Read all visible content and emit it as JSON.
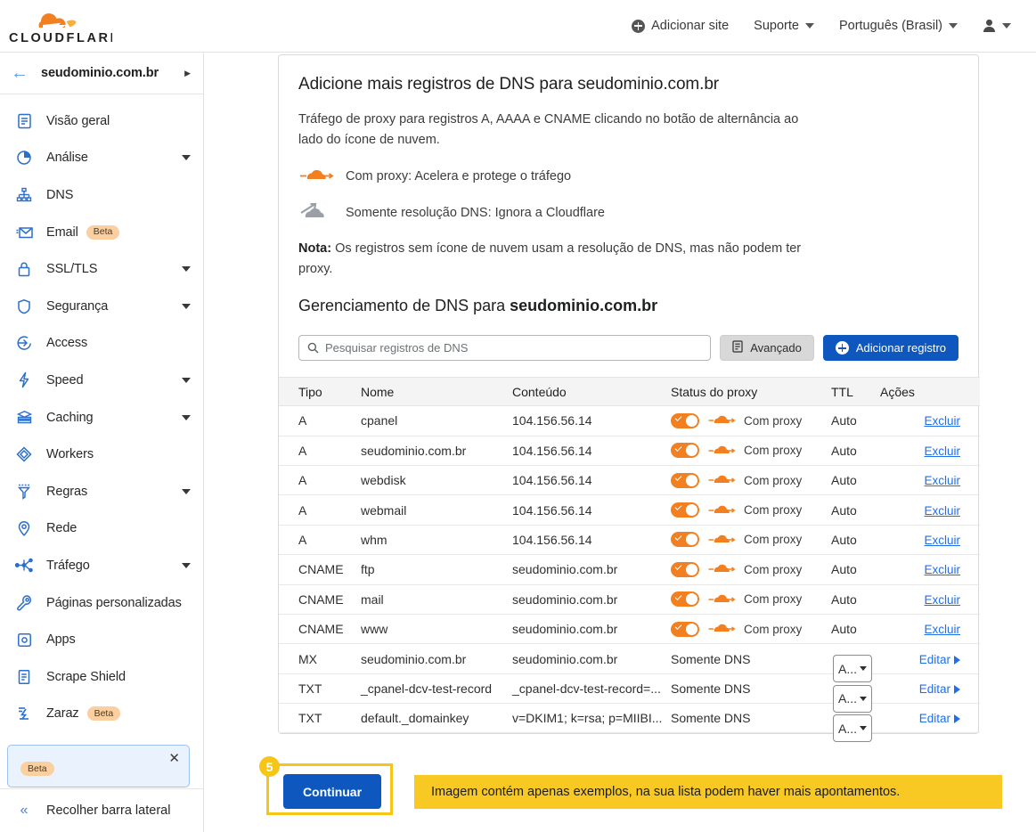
{
  "brand": {
    "name": "CLOUDFLARE",
    "logo_icon": "cloudflare-cloud-logo",
    "orange": "#f38020"
  },
  "topnav": {
    "add_site": {
      "label": "Adicionar site",
      "icon": "plus-circle-icon"
    },
    "support": {
      "label": "Suporte",
      "icon": "chevron-down-icon"
    },
    "language": {
      "label": "Português (Brasil)",
      "icon": "chevron-down-icon"
    },
    "account": {
      "icon": "person-icon",
      "caret_icon": "chevron-down-icon"
    }
  },
  "sidebar": {
    "back_icon": "back-arrow-icon",
    "domain": "seudominio.com.br",
    "expand_icon": "chevron-right-icon",
    "items": [
      {
        "label": "Visão geral",
        "icon": "clipboard-icon",
        "expandable": false
      },
      {
        "label": "Análise",
        "icon": "pie-chart-icon",
        "expandable": true
      },
      {
        "label": "DNS",
        "icon": "sitemap-icon",
        "expandable": false
      },
      {
        "label": "Email",
        "icon": "envelope-icon",
        "expandable": false,
        "badge": "Beta"
      },
      {
        "label": "SSL/TLS",
        "icon": "lock-icon",
        "expandable": true
      },
      {
        "label": "Segurança",
        "icon": "shield-icon",
        "expandable": true
      },
      {
        "label": "Access",
        "icon": "login-arrow-icon",
        "expandable": false
      },
      {
        "label": "Speed",
        "icon": "lightning-bolt-icon",
        "expandable": true
      },
      {
        "label": "Caching",
        "icon": "database-stack-icon",
        "expandable": true
      },
      {
        "label": "Workers",
        "icon": "workers-diamond-icon",
        "expandable": false
      },
      {
        "label": "Regras",
        "icon": "funnel-icon",
        "expandable": true
      },
      {
        "label": "Rede",
        "icon": "map-pin-icon",
        "expandable": false
      },
      {
        "label": "Tráfego",
        "icon": "network-nodes-icon",
        "expandable": true
      },
      {
        "label": "Páginas personalizadas",
        "icon": "wrench-icon",
        "expandable": false
      },
      {
        "label": "Apps",
        "icon": "app-square-icon",
        "expandable": false
      },
      {
        "label": "Scrape Shield",
        "icon": "document-icon",
        "expandable": false
      },
      {
        "label": "Zaraz",
        "icon": "zaraz-icon",
        "expandable": false,
        "badge": "Beta"
      }
    ],
    "promo": {
      "badge": "Beta",
      "close_icon": "close-x-icon"
    },
    "collapse": {
      "label": "Recolher barra lateral",
      "icon": "double-chevron-left-icon"
    }
  },
  "card": {
    "title": "Adicione mais registros de DNS para seudominio.com.br",
    "description": "Tráfego de proxy para registros A, AAAA e CNAME clicando no botão de alternância ao lado do ícone de nuvem.",
    "legend": [
      {
        "icon": "orange-cloud-proxied-icon",
        "text": "Com proxy: Acelera e protege o tráfego"
      },
      {
        "icon": "gray-cloud-dns-only-icon",
        "text": "Somente resolução DNS: Ignora a Cloudflare"
      }
    ],
    "note_label": "Nota:",
    "note_text": " Os registros sem ícone de nuvem usam a resolução de DNS, mas não podem ter proxy.",
    "management_prefix": "Gerenciamento de DNS para ",
    "management_domain": "seudominio.com.br"
  },
  "toolbar": {
    "search_placeholder": "Pesquisar registros de DNS",
    "search_value": "",
    "search_icon": "search-icon",
    "advanced_label": "Avançado",
    "advanced_icon": "list-document-icon",
    "add_record_label": "Adicionar registro",
    "add_record_icon": "plus-circle-icon"
  },
  "table": {
    "headers": [
      "Tipo",
      "Nome",
      "Conteúdo",
      "Status do proxy",
      "TTL",
      "Ações"
    ],
    "rows": [
      {
        "type": "A",
        "name": "cpanel",
        "content": "104.156.56.14",
        "proxy_toggle": true,
        "proxy_status": "Com proxy",
        "ttl": "Auto",
        "action": "Excluir",
        "action_kind": "delete"
      },
      {
        "type": "A",
        "name": "seudominio.com.br",
        "content": "104.156.56.14",
        "proxy_toggle": true,
        "proxy_status": "Com proxy",
        "ttl": "Auto",
        "action": "Excluir",
        "action_kind": "delete"
      },
      {
        "type": "A",
        "name": "webdisk",
        "content": "104.156.56.14",
        "proxy_toggle": true,
        "proxy_status": "Com proxy",
        "ttl": "Auto",
        "action": "Excluir",
        "action_kind": "delete"
      },
      {
        "type": "A",
        "name": "webmail",
        "content": "104.156.56.14",
        "proxy_toggle": true,
        "proxy_status": "Com proxy",
        "ttl": "Auto",
        "action": "Excluir",
        "action_kind": "delete"
      },
      {
        "type": "A",
        "name": "whm",
        "content": "104.156.56.14",
        "proxy_toggle": true,
        "proxy_status": "Com proxy",
        "ttl": "Auto",
        "action": "Excluir",
        "action_kind": "delete"
      },
      {
        "type": "CNAME",
        "name": "ftp",
        "content": "seudominio.com.br",
        "proxy_toggle": true,
        "proxy_status": "Com proxy",
        "ttl": "Auto",
        "action": "Excluir",
        "action_kind": "delete"
      },
      {
        "type": "CNAME",
        "name": "mail",
        "content": "seudominio.com.br",
        "proxy_toggle": true,
        "proxy_status": "Com proxy",
        "ttl": "Auto",
        "action": "Excluir",
        "action_kind": "delete"
      },
      {
        "type": "CNAME",
        "name": "www",
        "content": "seudominio.com.br",
        "proxy_toggle": true,
        "proxy_status": "Com proxy",
        "ttl": "Auto",
        "action": "Excluir",
        "action_kind": "delete"
      },
      {
        "type": "MX",
        "name": "seudominio.com.br",
        "content": "seudominio.com.br",
        "proxy_toggle": false,
        "proxy_status": "Somente DNS",
        "ttl": "A...",
        "action": "Editar",
        "action_kind": "edit"
      },
      {
        "type": "TXT",
        "name": "_cpanel-dcv-test-record",
        "content": "_cpanel-dcv-test-record=...",
        "proxy_toggle": false,
        "proxy_status": "Somente DNS",
        "ttl": "A...",
        "action": "Editar",
        "action_kind": "edit"
      },
      {
        "type": "TXT",
        "name": "default._domainkey",
        "content": "v=DKIM1; k=rsa; p=MIIBI...",
        "proxy_toggle": false,
        "proxy_status": "Somente DNS",
        "ttl": "A...",
        "action": "Editar",
        "action_kind": "edit"
      }
    ]
  },
  "footer": {
    "step_number": "5",
    "continue_label": "Continuar",
    "banner_text": "Imagem contém apenas exemplos, na sua lista podem haver mais apontamentos."
  }
}
